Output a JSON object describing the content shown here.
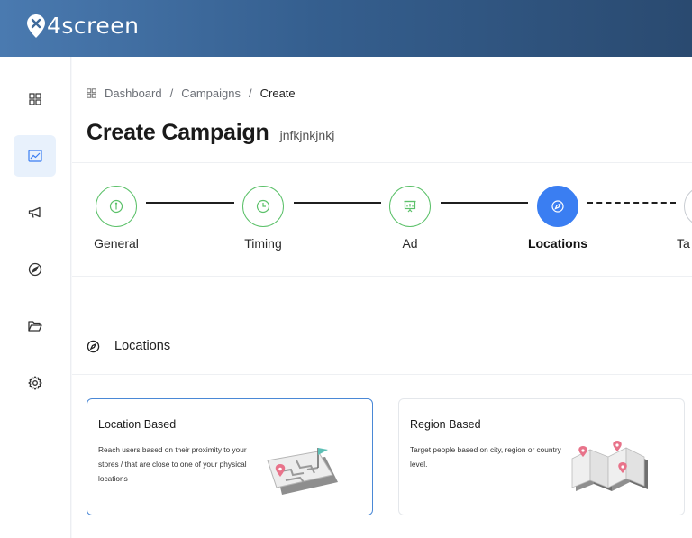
{
  "app": {
    "logo_text": "4screen"
  },
  "sidebar": {
    "items": [
      {
        "name": "dashboard",
        "icon": "grid-icon",
        "active": false
      },
      {
        "name": "campaigns",
        "icon": "chart-icon",
        "active": true
      },
      {
        "name": "announcements",
        "icon": "megaphone-icon",
        "active": false
      },
      {
        "name": "explore",
        "icon": "compass-icon",
        "active": false
      },
      {
        "name": "files",
        "icon": "folder-icon",
        "active": false
      },
      {
        "name": "settings",
        "icon": "gear-icon",
        "active": false
      }
    ]
  },
  "breadcrumb": {
    "items": [
      "Dashboard",
      "Campaigns",
      "Create"
    ],
    "separator": "/"
  },
  "page": {
    "title": "Create Campaign",
    "subtitle": "jnfkjnkjnkj"
  },
  "steps": [
    {
      "label": "General",
      "state": "done",
      "icon": "info-icon"
    },
    {
      "label": "Timing",
      "state": "done",
      "icon": "clock-icon"
    },
    {
      "label": "Ad",
      "state": "done",
      "icon": "presentation-icon"
    },
    {
      "label": "Locations",
      "state": "active",
      "icon": "compass-icon"
    },
    {
      "label": "Ta",
      "state": "pending",
      "icon": ""
    }
  ],
  "section": {
    "title": "Locations",
    "icon": "compass-icon"
  },
  "cards": [
    {
      "title": "Location Based",
      "description": "Reach users based on their proximity to your stores / that are close to one of your physical locations",
      "selected": true,
      "illustration": "maze-map-flag"
    },
    {
      "title": "Region Based",
      "description": "Target people based on city, region or country level.",
      "selected": false,
      "illustration": "folded-map-pins"
    }
  ],
  "colors": {
    "accent": "#3a7ef2",
    "success": "#5cc16a",
    "header_start": "#4a7ab0",
    "header_end": "#2a4a70",
    "selected_border": "#4a88d6"
  }
}
